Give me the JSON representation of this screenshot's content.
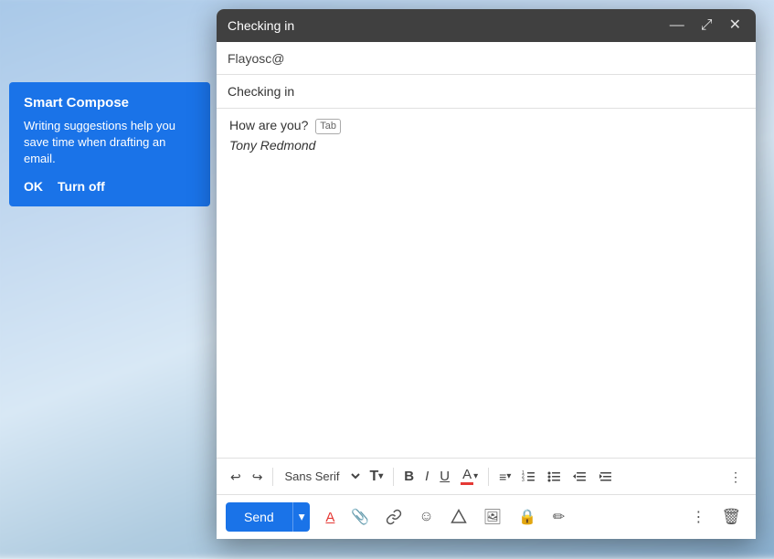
{
  "background": {
    "description": "blurred sky background"
  },
  "smart_compose": {
    "title": "Smart Compose",
    "description": "Writing suggestions help you save time when drafting an email.",
    "ok_label": "OK",
    "turn_off_label": "Turn off"
  },
  "compose_window": {
    "title": "Checking in",
    "titlebar_controls": {
      "minimize": "—",
      "expand": "⤢",
      "close": "✕"
    },
    "to_field": "Flayosc@",
    "subject_field": "Checking in",
    "body_line1": "How are you?",
    "tab_hint": "Tab",
    "body_line2": "Tony Redmond",
    "toolbar": {
      "undo": "↩",
      "redo": "↪",
      "font_name": "Sans Serif",
      "font_size_icon": "A",
      "bold": "B",
      "italic": "I",
      "underline": "U",
      "font_color": "A",
      "align": "≡",
      "numbered_list": "ol",
      "bullet_list": "ul",
      "indent_less": "«",
      "indent_more": "»",
      "more": "⋮"
    },
    "actions": {
      "send_label": "Send",
      "send_dropdown": "▾",
      "format_icon": "A",
      "attach_icon": "📎",
      "link_icon": "🔗",
      "emoji_icon": "☺",
      "drive_icon": "△",
      "image_icon": "🖼",
      "lock_icon": "🔒",
      "pencil_icon": "✏",
      "more_icon": "⋮",
      "delete_icon": "🗑"
    }
  }
}
